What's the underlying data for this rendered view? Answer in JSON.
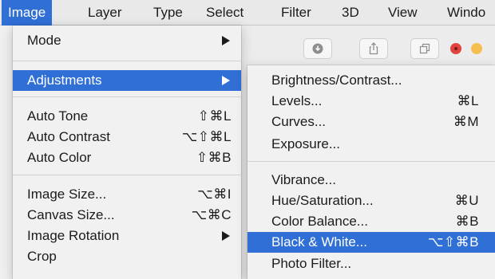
{
  "menubar": {
    "items": [
      {
        "label": "Image"
      },
      {
        "label": "Layer"
      },
      {
        "label": "Type"
      },
      {
        "label": "Select"
      },
      {
        "label": "Filter"
      },
      {
        "label": "3D"
      },
      {
        "label": "View"
      },
      {
        "label": "Windo"
      }
    ]
  },
  "background_window": {
    "toolbar_icons": [
      "download-icon",
      "share-icon",
      "duplicate-icon"
    ],
    "traffic_light_colors": [
      "#e0443e",
      "#f4bf4f"
    ]
  },
  "image_menu": {
    "items": [
      {
        "label": "Mode",
        "has_submenu": true
      },
      {
        "label": "Adjustments",
        "has_submenu": true,
        "highlighted": true
      },
      {
        "label": "Auto Tone",
        "shortcut": "⇧⌘L"
      },
      {
        "label": "Auto Contrast",
        "shortcut": "⌥⇧⌘L"
      },
      {
        "label": "Auto Color",
        "shortcut": "⇧⌘B"
      },
      {
        "label": "Image Size...",
        "shortcut": "⌥⌘I"
      },
      {
        "label": "Canvas Size...",
        "shortcut": "⌥⌘C"
      },
      {
        "label": "Image Rotation",
        "has_submenu": true
      },
      {
        "label": "Crop"
      }
    ]
  },
  "adjustments_submenu": {
    "items": [
      {
        "label": "Brightness/Contrast..."
      },
      {
        "label": "Levels...",
        "shortcut": "⌘L"
      },
      {
        "label": "Curves...",
        "shortcut": "⌘M"
      },
      {
        "label": "Exposure..."
      },
      {
        "label": "Vibrance..."
      },
      {
        "label": "Hue/Saturation...",
        "shortcut": "⌘U"
      },
      {
        "label": "Color Balance...",
        "shortcut": "⌘B"
      },
      {
        "label": "Black & White...",
        "shortcut": "⌥⇧⌘B",
        "highlighted": true
      },
      {
        "label": "Photo Filter..."
      }
    ]
  },
  "colors": {
    "highlight": "#2f6fd6",
    "menu_background": "#f1f1f1"
  }
}
